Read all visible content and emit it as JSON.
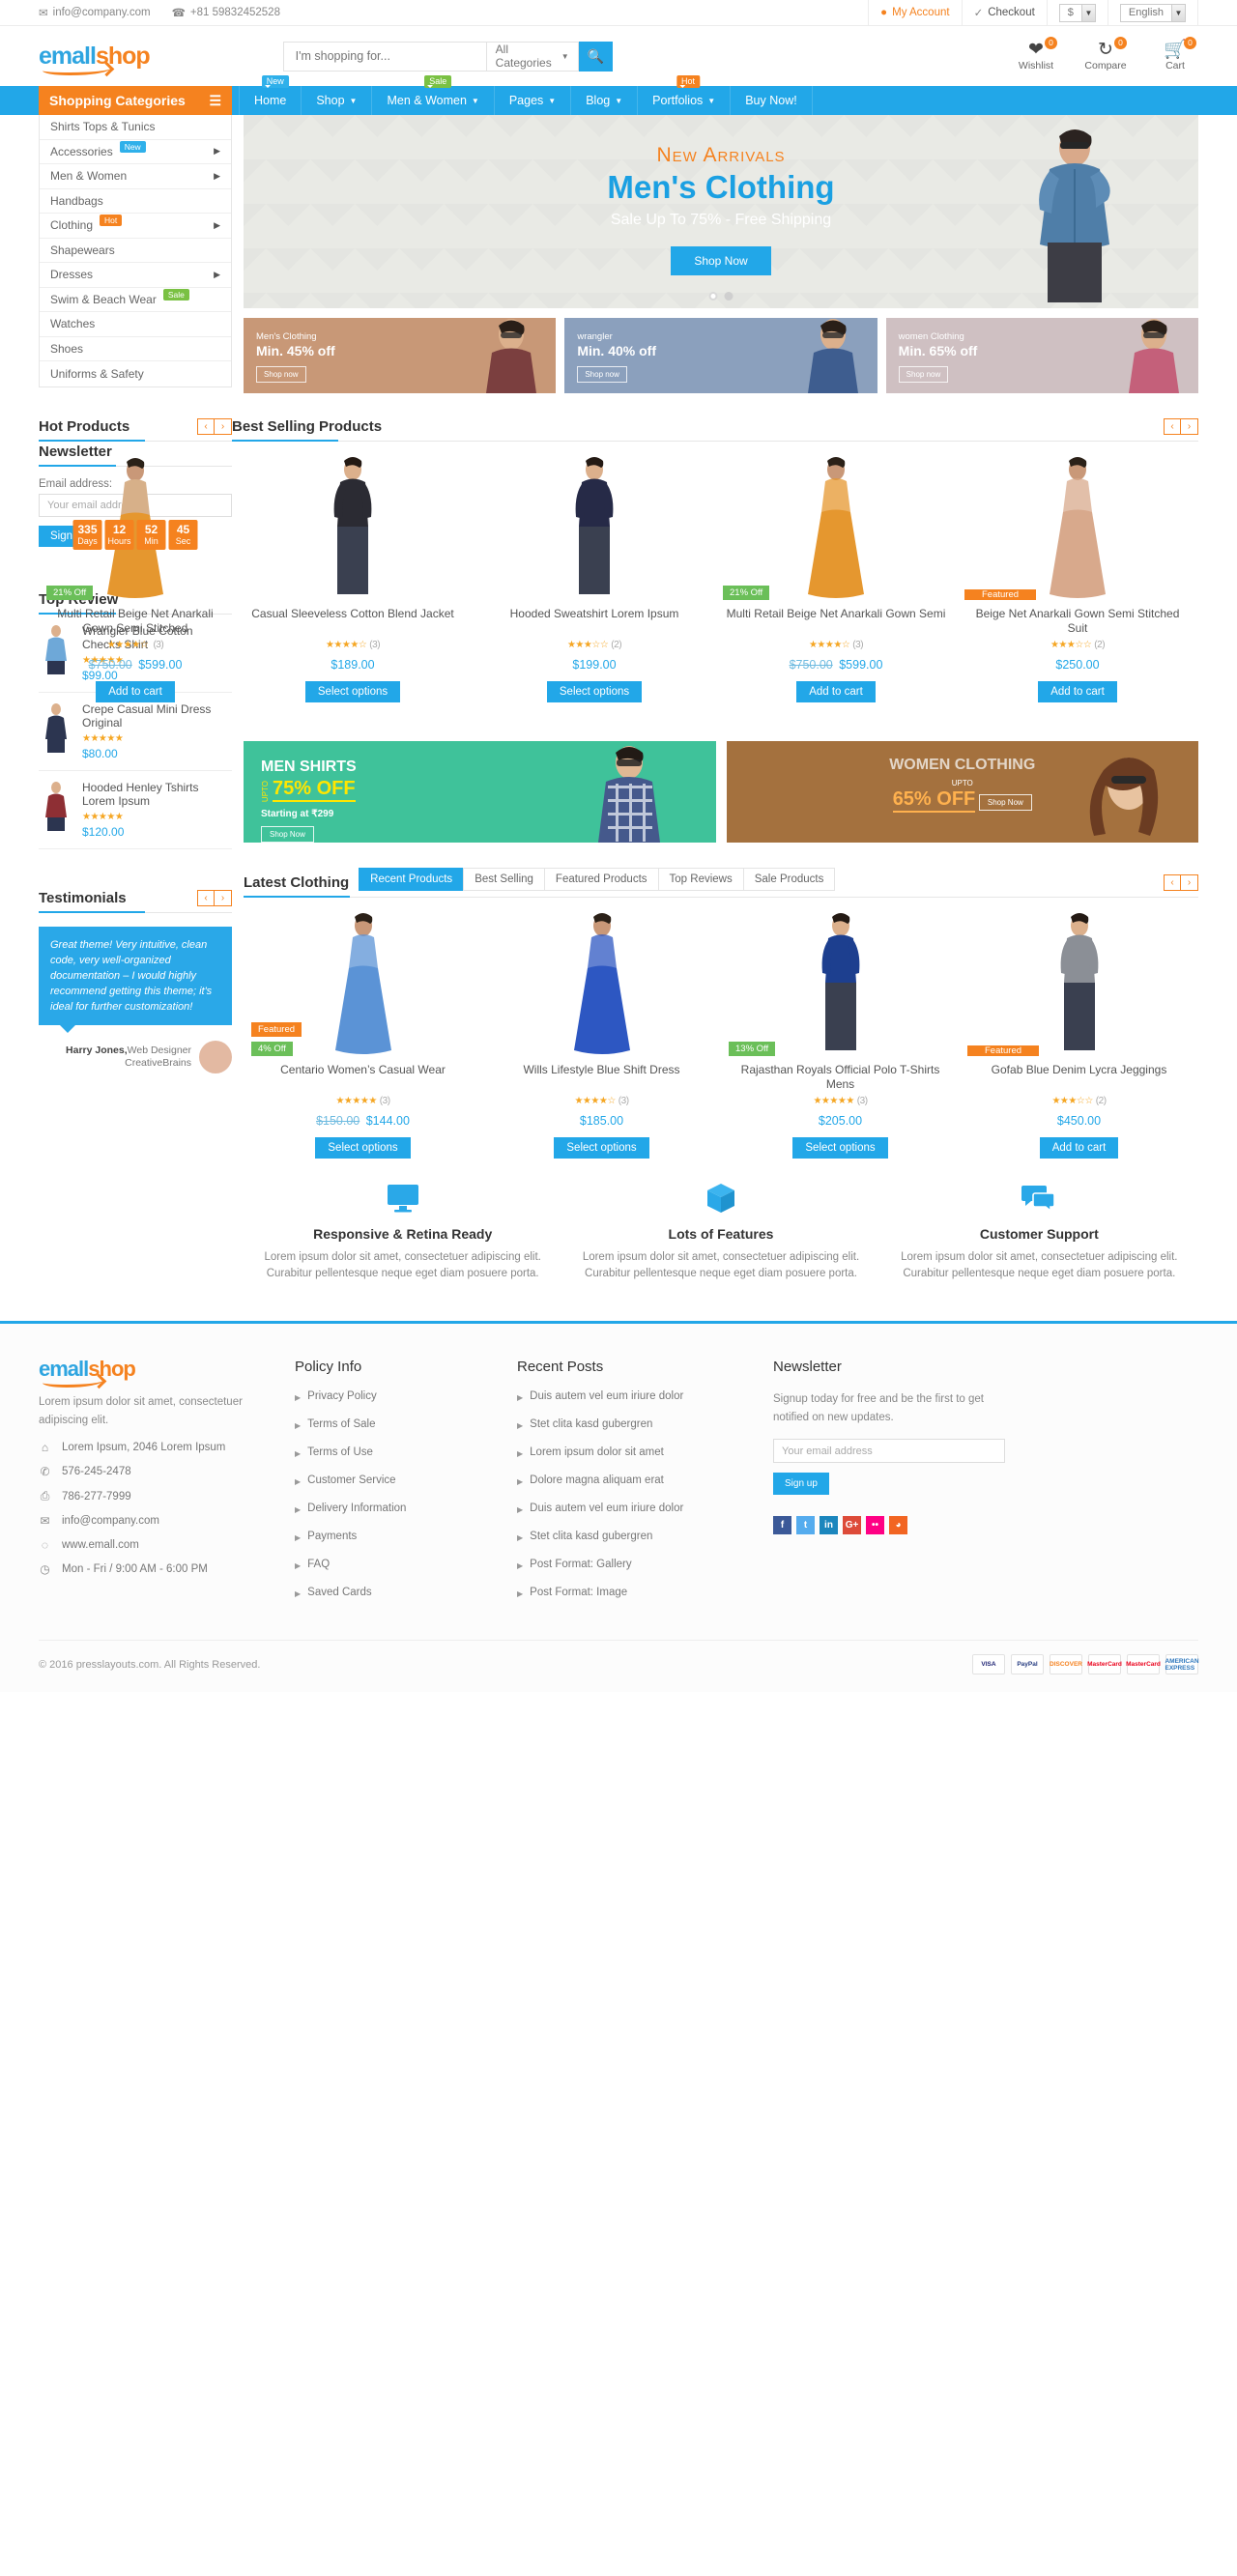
{
  "topbar": {
    "email": "info@company.com",
    "phone": "+81 59832452528",
    "account": "My Account",
    "checkout": "Checkout",
    "currency": "$",
    "language": "English"
  },
  "header": {
    "logo_a": "emall",
    "logo_b": "shop",
    "search_placeholder": "I'm shopping for...",
    "categories_label": "All Categories",
    "icons": [
      {
        "label": "Wishlist",
        "count": "0",
        "glyph": "♥"
      },
      {
        "label": "Compare",
        "count": "0",
        "glyph": "↻"
      },
      {
        "label": "Cart",
        "count": "0",
        "glyph": "🛒"
      }
    ]
  },
  "nav": [
    {
      "label": "Home",
      "tip": "New",
      "tip_type": "new",
      "caret": false
    },
    {
      "label": "Shop",
      "tip": "",
      "tip_type": "",
      "caret": true
    },
    {
      "label": "Men & Women",
      "tip": "Sale",
      "tip_type": "sale",
      "caret": true
    },
    {
      "label": "Pages",
      "tip": "",
      "tip_type": "",
      "caret": true
    },
    {
      "label": "Blog",
      "tip": "",
      "tip_type": "",
      "caret": true
    },
    {
      "label": "Portfolios",
      "tip": "Hot",
      "tip_type": "hot",
      "caret": true
    },
    {
      "label": "Buy Now!",
      "tip": "",
      "tip_type": "",
      "caret": false
    }
  ],
  "categories": {
    "title": "Shopping Categories",
    "items": [
      {
        "label": "Shirts Tops & Tunics",
        "tip": "",
        "tip_type": "",
        "caret": false
      },
      {
        "label": "Accessories",
        "tip": "New",
        "tip_type": "new",
        "caret": true
      },
      {
        "label": "Men & Women",
        "tip": "",
        "tip_type": "",
        "caret": true
      },
      {
        "label": "Handbags",
        "tip": "",
        "tip_type": "",
        "caret": false
      },
      {
        "label": "Clothing",
        "tip": "Hot",
        "tip_type": "hot",
        "caret": true
      },
      {
        "label": "Shapewears",
        "tip": "",
        "tip_type": "",
        "caret": false
      },
      {
        "label": "Dresses",
        "tip": "",
        "tip_type": "",
        "caret": true
      },
      {
        "label": "Swim & Beach Wear",
        "tip": "Sale",
        "tip_type": "sale",
        "caret": false
      },
      {
        "label": "Watches",
        "tip": "",
        "tip_type": "",
        "caret": false
      },
      {
        "label": "Shoes",
        "tip": "",
        "tip_type": "",
        "caret": false
      },
      {
        "label": "Uniforms & Safety",
        "tip": "",
        "tip_type": "",
        "caret": false
      }
    ]
  },
  "hero": {
    "eyebrow": "New Arrivals",
    "title": "Men's Clothing",
    "subtitle": "Sale Up To 75% - Free Shipping",
    "button": "Shop Now"
  },
  "promos": [
    {
      "title": "Men's Clothing",
      "offer": "Min. 45% off",
      "button": "Shop now",
      "bg": "#c89877"
    },
    {
      "title": "wrangler",
      "offer": "Min. 40% off",
      "button": "Shop now",
      "bg": "#8ba0bd"
    },
    {
      "title": "women Clothing",
      "offer": "Min. 65% off",
      "button": "Shop now",
      "bg": "#cfc0c2"
    }
  ],
  "hot_products": {
    "title": "Hot Products",
    "countdown": [
      {
        "n": "335",
        "u": "Days"
      },
      {
        "n": "12",
        "u": "Hours"
      },
      {
        "n": "52",
        "u": "Min"
      },
      {
        "n": "45",
        "u": "Sec"
      }
    ],
    "product": {
      "name": "Multi Retail Beige Net Anarkali Gown Semi Stitched",
      "badge": "21% Off",
      "stars": "★★★★☆",
      "count": "(3)",
      "old_price": "$750.00",
      "price": "$599.00",
      "button": "Add to cart"
    }
  },
  "best_selling": {
    "title": "Best Selling Products",
    "items": [
      {
        "name": "Casual Sleeveless Cotton Blend Jacket",
        "stars": "★★★★☆",
        "count": "(3)",
        "old_price": "",
        "price": "$189.00",
        "button": "Select options",
        "badge": "",
        "badge_type": "",
        "color": "#2b2b33"
      },
      {
        "name": "Hooded Sweatshirt Lorem Ipsum",
        "stars": "★★★☆☆",
        "count": "(2)",
        "old_price": "",
        "price": "$199.00",
        "button": "Select options",
        "badge": "",
        "badge_type": "",
        "color": "#262a47"
      },
      {
        "name": "Multi Retail Beige Net Anarkali Gown Semi",
        "stars": "★★★★☆",
        "count": "(3)",
        "old_price": "$750.00",
        "price": "$599.00",
        "button": "Add to cart",
        "badge": "21% Off",
        "badge_type": "off",
        "color": "#e5972f"
      },
      {
        "name": "Beige Net Anarkali Gown Semi Stitched Suit",
        "stars": "★★★☆☆",
        "count": "(2)",
        "old_price": "",
        "price": "$250.00",
        "button": "Add to cart",
        "badge": "Featured",
        "badge_type": "feat",
        "color": "#d8a98c"
      }
    ]
  },
  "newsletter_widget": {
    "title": "Newsletter",
    "label": "Email address:",
    "placeholder": "Your email address",
    "button": "Sign up"
  },
  "top_review": {
    "title": "Top Review",
    "items": [
      {
        "name": "Wrangler Blue Cotton Checks Shirt",
        "stars": "★★★★★",
        "price": "$99.00",
        "color": "#6ea8d8"
      },
      {
        "name": "Crepe Casual Mini Dress Original",
        "stars": "★★★★★",
        "price": "$80.00",
        "color": "#2c3550"
      },
      {
        "name": "Hooded Henley Tshirts Lorem Ipsum",
        "stars": "★★★★★",
        "price": "$120.00",
        "color": "#8e2f34"
      }
    ]
  },
  "mid_banners": [
    {
      "title": "MEN SHIRTS",
      "upto": "UPTO",
      "pct": "75% OFF",
      "sub": "Starting at ₹299",
      "button": "Shop Now"
    },
    {
      "title": "WOMEN CLOTHING",
      "upto": "UPTO",
      "pct": "65% OFF",
      "sub": "",
      "button": "Shop Now"
    }
  ],
  "latest": {
    "title": "Latest Clothing",
    "tabs": [
      "Recent Products",
      "Best Selling",
      "Featured Products",
      "Top Reviews",
      "Sale Products"
    ],
    "active_tab": "Recent Products",
    "items": [
      {
        "name": "Centario Women’s Casual Wear",
        "stars": "★★★★★",
        "count": "(3)",
        "old_price": "$150.00",
        "price": "$144.00",
        "button": "Select options",
        "badges": [
          {
            "text": "Featured",
            "type": "feat2"
          },
          {
            "text": "4% Off",
            "type": "off"
          }
        ],
        "color": "#5b93d6"
      },
      {
        "name": "Wills Lifestyle Blue Shift Dress",
        "stars": "★★★★☆",
        "count": "(3)",
        "old_price": "",
        "price": "$185.00",
        "button": "Select options",
        "badges": [],
        "color": "#2d57c2"
      },
      {
        "name": "Rajasthan Royals Official Polo T-Shirts Mens",
        "stars": "★★★★★",
        "count": "(3)",
        "old_price": "",
        "price": "$205.00",
        "button": "Select options",
        "badges": [
          {
            "text": "13% Off",
            "type": "off"
          }
        ],
        "color": "#1d3f8f"
      },
      {
        "name": "Gofab Blue Denim Lycra Jeggings",
        "stars": "★★★☆☆",
        "count": "(2)",
        "old_price": "",
        "price": "$450.00",
        "button": "Add to cart",
        "badges": [
          {
            "text": "Featured",
            "type": "feat"
          }
        ],
        "color": "#8b8f96"
      }
    ]
  },
  "testimonials": {
    "title": "Testimonials",
    "quote": "Great theme! Very intuitive, clean code, very well-organized documentation – I would highly recommend getting this theme; it's ideal for further customization!",
    "author": "Harry Jones,",
    "role": "Web Designer",
    "company": "CreativeBrains"
  },
  "features": [
    {
      "title": "Responsive & Retina Ready",
      "text": "Lorem ipsum dolor sit amet, consectetuer adipiscing elit. Curabitur pellentesque neque eget diam posuere porta.",
      "icon": "monitor-icon"
    },
    {
      "title": "Lots of Features",
      "text": "Lorem ipsum dolor sit amet, consectetuer adipiscing elit. Curabitur pellentesque neque eget diam posuere porta.",
      "icon": "cube-icon"
    },
    {
      "title": "Customer Support",
      "text": "Lorem ipsum dolor sit amet, consectetuer adipiscing elit. Curabitur pellentesque neque eget diam posuere porta.",
      "icon": "chat-icon"
    }
  ],
  "footer": {
    "logo_a": "emall",
    "logo_b": "shop",
    "desc": "Lorem ipsum dolor sit amet, consectetuer adipiscing elit.",
    "contacts": [
      {
        "icon": "home-icon",
        "glyph": "⌂",
        "text": "Lorem Ipsum, 2046 Lorem Ipsum"
      },
      {
        "icon": "phone-icon",
        "glyph": "✆",
        "text": "576-245-2478"
      },
      {
        "icon": "fax-icon",
        "glyph": "⎙",
        "text": "786-277-7999"
      },
      {
        "icon": "email-icon",
        "glyph": "✉",
        "text": "info@company.com"
      },
      {
        "icon": "globe-icon",
        "glyph": "◌",
        "text": "www.emall.com"
      },
      {
        "icon": "clock-icon",
        "glyph": "◷",
        "text": "Mon - Fri / 9:00 AM - 6:00 PM"
      }
    ],
    "policy": {
      "title": "Policy Info",
      "links": [
        "Privacy Policy",
        "Terms of Sale",
        "Terms of Use",
        "Customer Service",
        "Delivery Information",
        "Payments",
        "FAQ",
        "Saved Cards"
      ]
    },
    "posts": {
      "title": "Recent Posts",
      "links": [
        "Duis autem vel eum iriure dolor",
        "Stet clita kasd gubergren",
        "Lorem ipsum dolor sit amet",
        "Dolore magna aliquam erat",
        "Duis autem vel eum iriure dolor",
        "Stet clita kasd gubergren",
        "Post Format: Gallery",
        "Post Format: Image"
      ]
    },
    "newsletter": {
      "title": "Newsletter",
      "text": "Signup today for free and be the first to get notified on new updates.",
      "placeholder": "Your email address",
      "button": "Sign up"
    },
    "socials": [
      {
        "name": "facebook-icon",
        "glyph": "f",
        "color": "#3b5998"
      },
      {
        "name": "twitter-icon",
        "glyph": "t",
        "color": "#55acee"
      },
      {
        "name": "linkedin-icon",
        "glyph": "in",
        "color": "#1b86bd"
      },
      {
        "name": "google-plus-icon",
        "glyph": "G+",
        "color": "#dd4b39"
      },
      {
        "name": "flickr-icon",
        "glyph": "••",
        "color": "#ff0084"
      },
      {
        "name": "rss-icon",
        "glyph": "◕",
        "color": "#f26522"
      }
    ],
    "copyright": "© 2016 presslayouts.com. All Rights Reserved.",
    "payment_cards": [
      "VISA",
      "PayPal",
      "DISCOVER",
      "MasterCard",
      "MasterCard",
      "AMERICAN EXPRESS"
    ]
  }
}
